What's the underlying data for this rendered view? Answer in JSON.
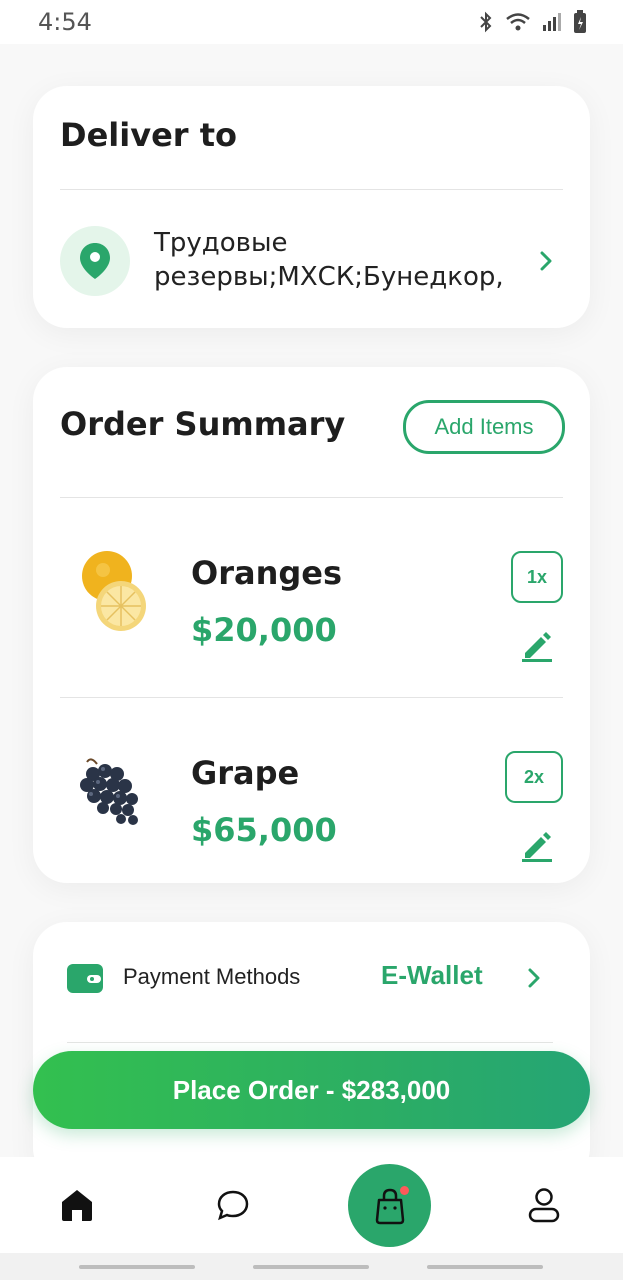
{
  "status_bar": {
    "time": "4:54"
  },
  "deliver": {
    "title": "Deliver to",
    "address": "Трудовые резервы;МХСК;Бунедкор,"
  },
  "order_summary": {
    "title": "Order Summary",
    "add_items_label": "Add Items",
    "items": [
      {
        "name": "Oranges",
        "price": "$20,000",
        "qty": "1x"
      },
      {
        "name": "Grape",
        "price": "$65,000",
        "qty": "2x"
      }
    ]
  },
  "payment": {
    "label": "Payment Methods",
    "value": "E-Wallet"
  },
  "place_order_label": "Place Order - $283,000",
  "colors": {
    "accent": "#2aa66b",
    "accent_light": "#e4f5ea",
    "badge": "#ff5a5a"
  },
  "icons": {
    "home": "home-icon",
    "chat": "chat-icon",
    "bag": "shopping-bag-icon",
    "profile": "profile-icon",
    "location": "location-pin-icon",
    "wallet": "wallet-icon",
    "edit": "edit-icon",
    "chevron": "chevron-right-icon"
  }
}
